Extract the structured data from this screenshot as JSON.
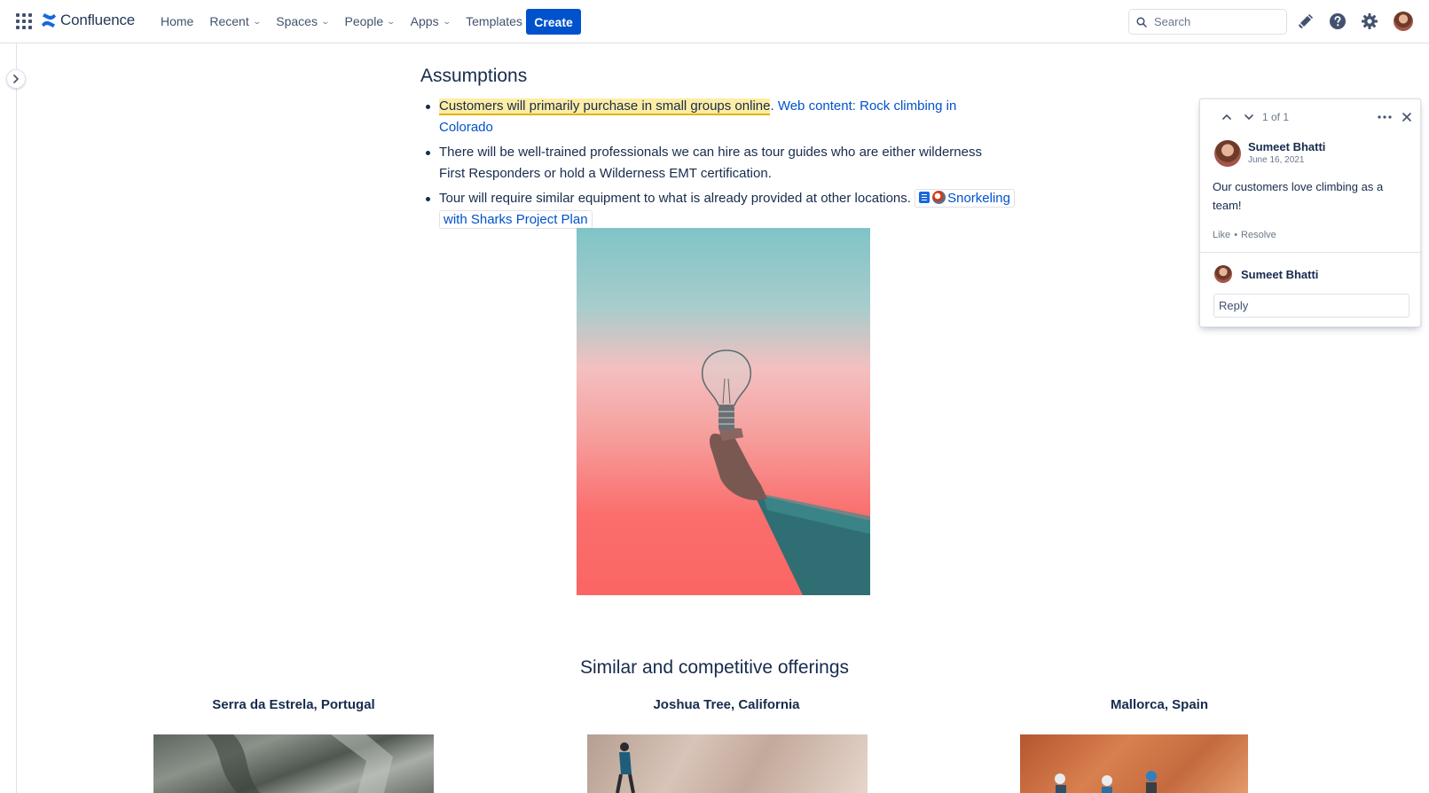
{
  "nav": {
    "logo_text": "Confluence",
    "items": [
      {
        "label": "Home",
        "has_dropdown": false
      },
      {
        "label": "Recent",
        "has_dropdown": true
      },
      {
        "label": "Spaces",
        "has_dropdown": true
      },
      {
        "label": "People",
        "has_dropdown": true
      },
      {
        "label": "Apps",
        "has_dropdown": true
      },
      {
        "label": "Templates",
        "has_dropdown": false
      }
    ],
    "create_label": "Create",
    "search_placeholder": "Search",
    "accent": "#0052cc"
  },
  "content": {
    "assumptions_heading": "Assumptions",
    "bullet1_highlight": "Customers will primarily purchase in small groups online",
    "bullet1_sep": ".",
    "bullet1_link": "Web content: Rock climbing in Colorado",
    "bullet2": "There will be well-trained professionals we can hire as tour guides who are either wilderness First Responders or hold a Wilderness EMT certification.",
    "bullet3_text": "Tour will require similar equipment to what is already provided at other locations.",
    "bullet3_link": "Snorkeling with Sharks Project Plan",
    "offerings_heading": "Similar and competitive offerings",
    "offerings": [
      {
        "title": "Serra da Estrela, Portugal"
      },
      {
        "title": "Joshua Tree, California"
      },
      {
        "title": "Mallorca, Spain"
      }
    ],
    "highlight_color": "#fdeda4"
  },
  "comment": {
    "count_text": "1 of 1",
    "author": "Sumeet Bhatti",
    "date": "June 16, 2021",
    "body": "Our customers love climbing as a team!",
    "like_label": "Like",
    "dot": "•",
    "resolve_label": "Resolve",
    "reply_author": "Sumeet Bhatti",
    "reply_placeholder": "Reply"
  }
}
